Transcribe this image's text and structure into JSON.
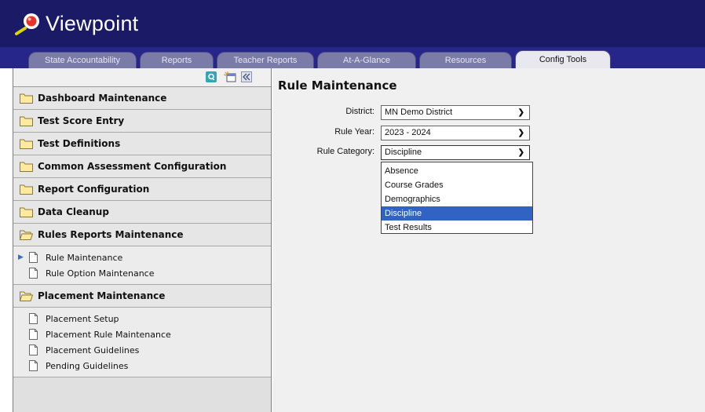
{
  "app": {
    "title": "Viewpoint",
    "colors": {
      "header": "#1a1a66",
      "tabbar": "#26268a",
      "selection": "#3163c4"
    }
  },
  "tabs": [
    {
      "label": "State Accountability",
      "active": false
    },
    {
      "label": "Reports",
      "active": false
    },
    {
      "label": "Teacher Reports",
      "active": false
    },
    {
      "label": "At-A-Glance",
      "active": false
    },
    {
      "label": "Resources",
      "active": false
    },
    {
      "label": "Config Tools",
      "active": true
    }
  ],
  "sidebar": {
    "toolbar_icons": [
      "q-search-icon",
      "new-window-icon",
      "collapse-left-icon"
    ],
    "sections": [
      {
        "label": "Dashboard Maintenance",
        "open": false
      },
      {
        "label": "Test Score Entry",
        "open": false
      },
      {
        "label": "Test Definitions",
        "open": false
      },
      {
        "label": "Common Assessment Configuration",
        "open": false
      },
      {
        "label": "Report Configuration",
        "open": false
      },
      {
        "label": "Data Cleanup",
        "open": false
      },
      {
        "label": "Rules Reports Maintenance",
        "open": true,
        "items": [
          {
            "label": "Rule Maintenance",
            "current": true
          },
          {
            "label": "Rule Option Maintenance",
            "current": false
          }
        ]
      },
      {
        "label": "Placement Maintenance",
        "open": true,
        "items": [
          {
            "label": "Placement Setup"
          },
          {
            "label": "Placement Rule Maintenance"
          },
          {
            "label": "Placement Guidelines"
          },
          {
            "label": "Pending Guidelines"
          }
        ]
      }
    ]
  },
  "main": {
    "title": "Rule Maintenance",
    "fields": {
      "district": {
        "label": "District:",
        "value": "MN Demo District"
      },
      "rule_year": {
        "label": "Rule Year:",
        "value": "2023 - 2024"
      },
      "rule_category": {
        "label": "Rule Category:",
        "value": "Discipline"
      }
    },
    "category_options": [
      "Absence",
      "Course Grades",
      "Demographics",
      "Discipline",
      "Test Results"
    ],
    "selected_option": "Discipline"
  }
}
